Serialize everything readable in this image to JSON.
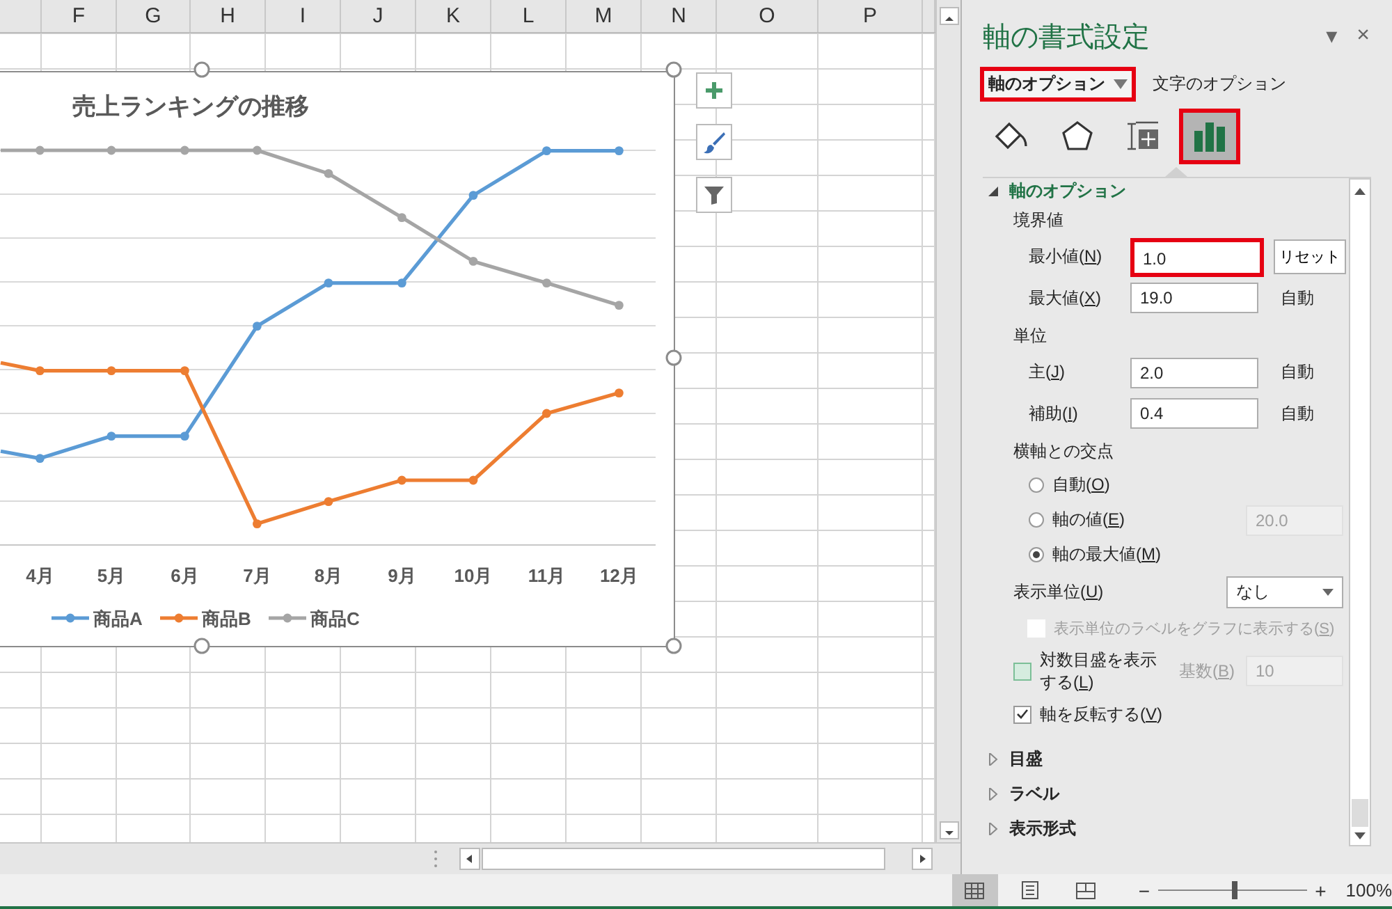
{
  "sheet": {
    "columns": [
      "",
      "F",
      "G",
      "H",
      "I",
      "J",
      "K",
      "L",
      "M",
      "N",
      "O",
      "P"
    ]
  },
  "chart": {
    "title": "売上ランキングの推移",
    "x_labels": [
      "4月",
      "5月",
      "6月",
      "7月",
      "8月",
      "9月",
      "10月",
      "11月",
      "12月"
    ],
    "legend": [
      {
        "name": "商品A",
        "color": "#5b9bd5"
      },
      {
        "name": "商品B",
        "color": "#ed7d31"
      },
      {
        "name": "商品C",
        "color": "#a5a5a5"
      }
    ]
  },
  "pane": {
    "title": "軸の書式設定",
    "menu_glyph": "▾",
    "close_glyph": "×",
    "tabs": [
      {
        "label": "軸のオプション",
        "selected": true,
        "highlighted": true
      },
      {
        "label": "文字のオプション",
        "selected": false,
        "highlighted": false
      }
    ],
    "icon_tabs": [
      {
        "kind": "fill",
        "selected": false,
        "highlighted": false
      },
      {
        "kind": "effects",
        "selected": false,
        "highlighted": false
      },
      {
        "kind": "size",
        "selected": false,
        "highlighted": false
      },
      {
        "kind": "options",
        "selected": true,
        "highlighted": true
      }
    ],
    "section": {
      "title": "軸のオプション",
      "expanded": true
    },
    "rows": [
      {
        "kind": "heading",
        "label": "境界値"
      },
      {
        "kind": "field",
        "label": "最小値(N)",
        "value": "1.0",
        "button": "リセット",
        "highlighted": true
      },
      {
        "kind": "field",
        "label": "最大値(X)",
        "value": "19.0",
        "note": "自動",
        "highlighted": false
      },
      {
        "kind": "heading",
        "label": "単位"
      },
      {
        "kind": "field",
        "label": "主(J)",
        "value": "2.0",
        "note": "自動",
        "highlighted": false
      },
      {
        "kind": "field",
        "label": "補助(I)",
        "value": "0.4",
        "note": "自動",
        "highlighted": false
      },
      {
        "kind": "heading",
        "label": "横軸との交点"
      },
      {
        "kind": "radio",
        "label": "自動(O)",
        "selected": false
      },
      {
        "kind": "radio",
        "label": "軸の値(E)",
        "selected": false,
        "value": "20.0"
      },
      {
        "kind": "radio",
        "label": "軸の最大値(M)",
        "selected": true
      },
      {
        "kind": "select",
        "label": "表示単位(U)",
        "value": "なし"
      },
      {
        "kind": "checkbox",
        "label": "表示単位のラベルをグラフに表示する(S)",
        "checked": false,
        "disabled": true
      },
      {
        "kind": "checkbox",
        "label": "対数目盛を表示する(L)",
        "checked": false,
        "disabled": false,
        "extra_label": "基数(B)",
        "value": "10"
      },
      {
        "kind": "checkbox",
        "label": "軸を反転する(V)",
        "checked": true,
        "disabled": false
      }
    ],
    "sections": [
      {
        "label": "目盛",
        "expanded": false
      },
      {
        "label": "ラベル",
        "expanded": false
      },
      {
        "label": "表示形式",
        "expanded": false
      }
    ]
  },
  "status_bar": {
    "views": [
      {
        "kind": "normal",
        "selected": true
      },
      {
        "kind": "layout",
        "selected": false
      },
      {
        "kind": "break",
        "selected": false
      }
    ],
    "zoom_out": "−",
    "zoom_in": "+",
    "zoom_level": {
      "level": 0.52
    },
    "zoom": "100%"
  }
}
